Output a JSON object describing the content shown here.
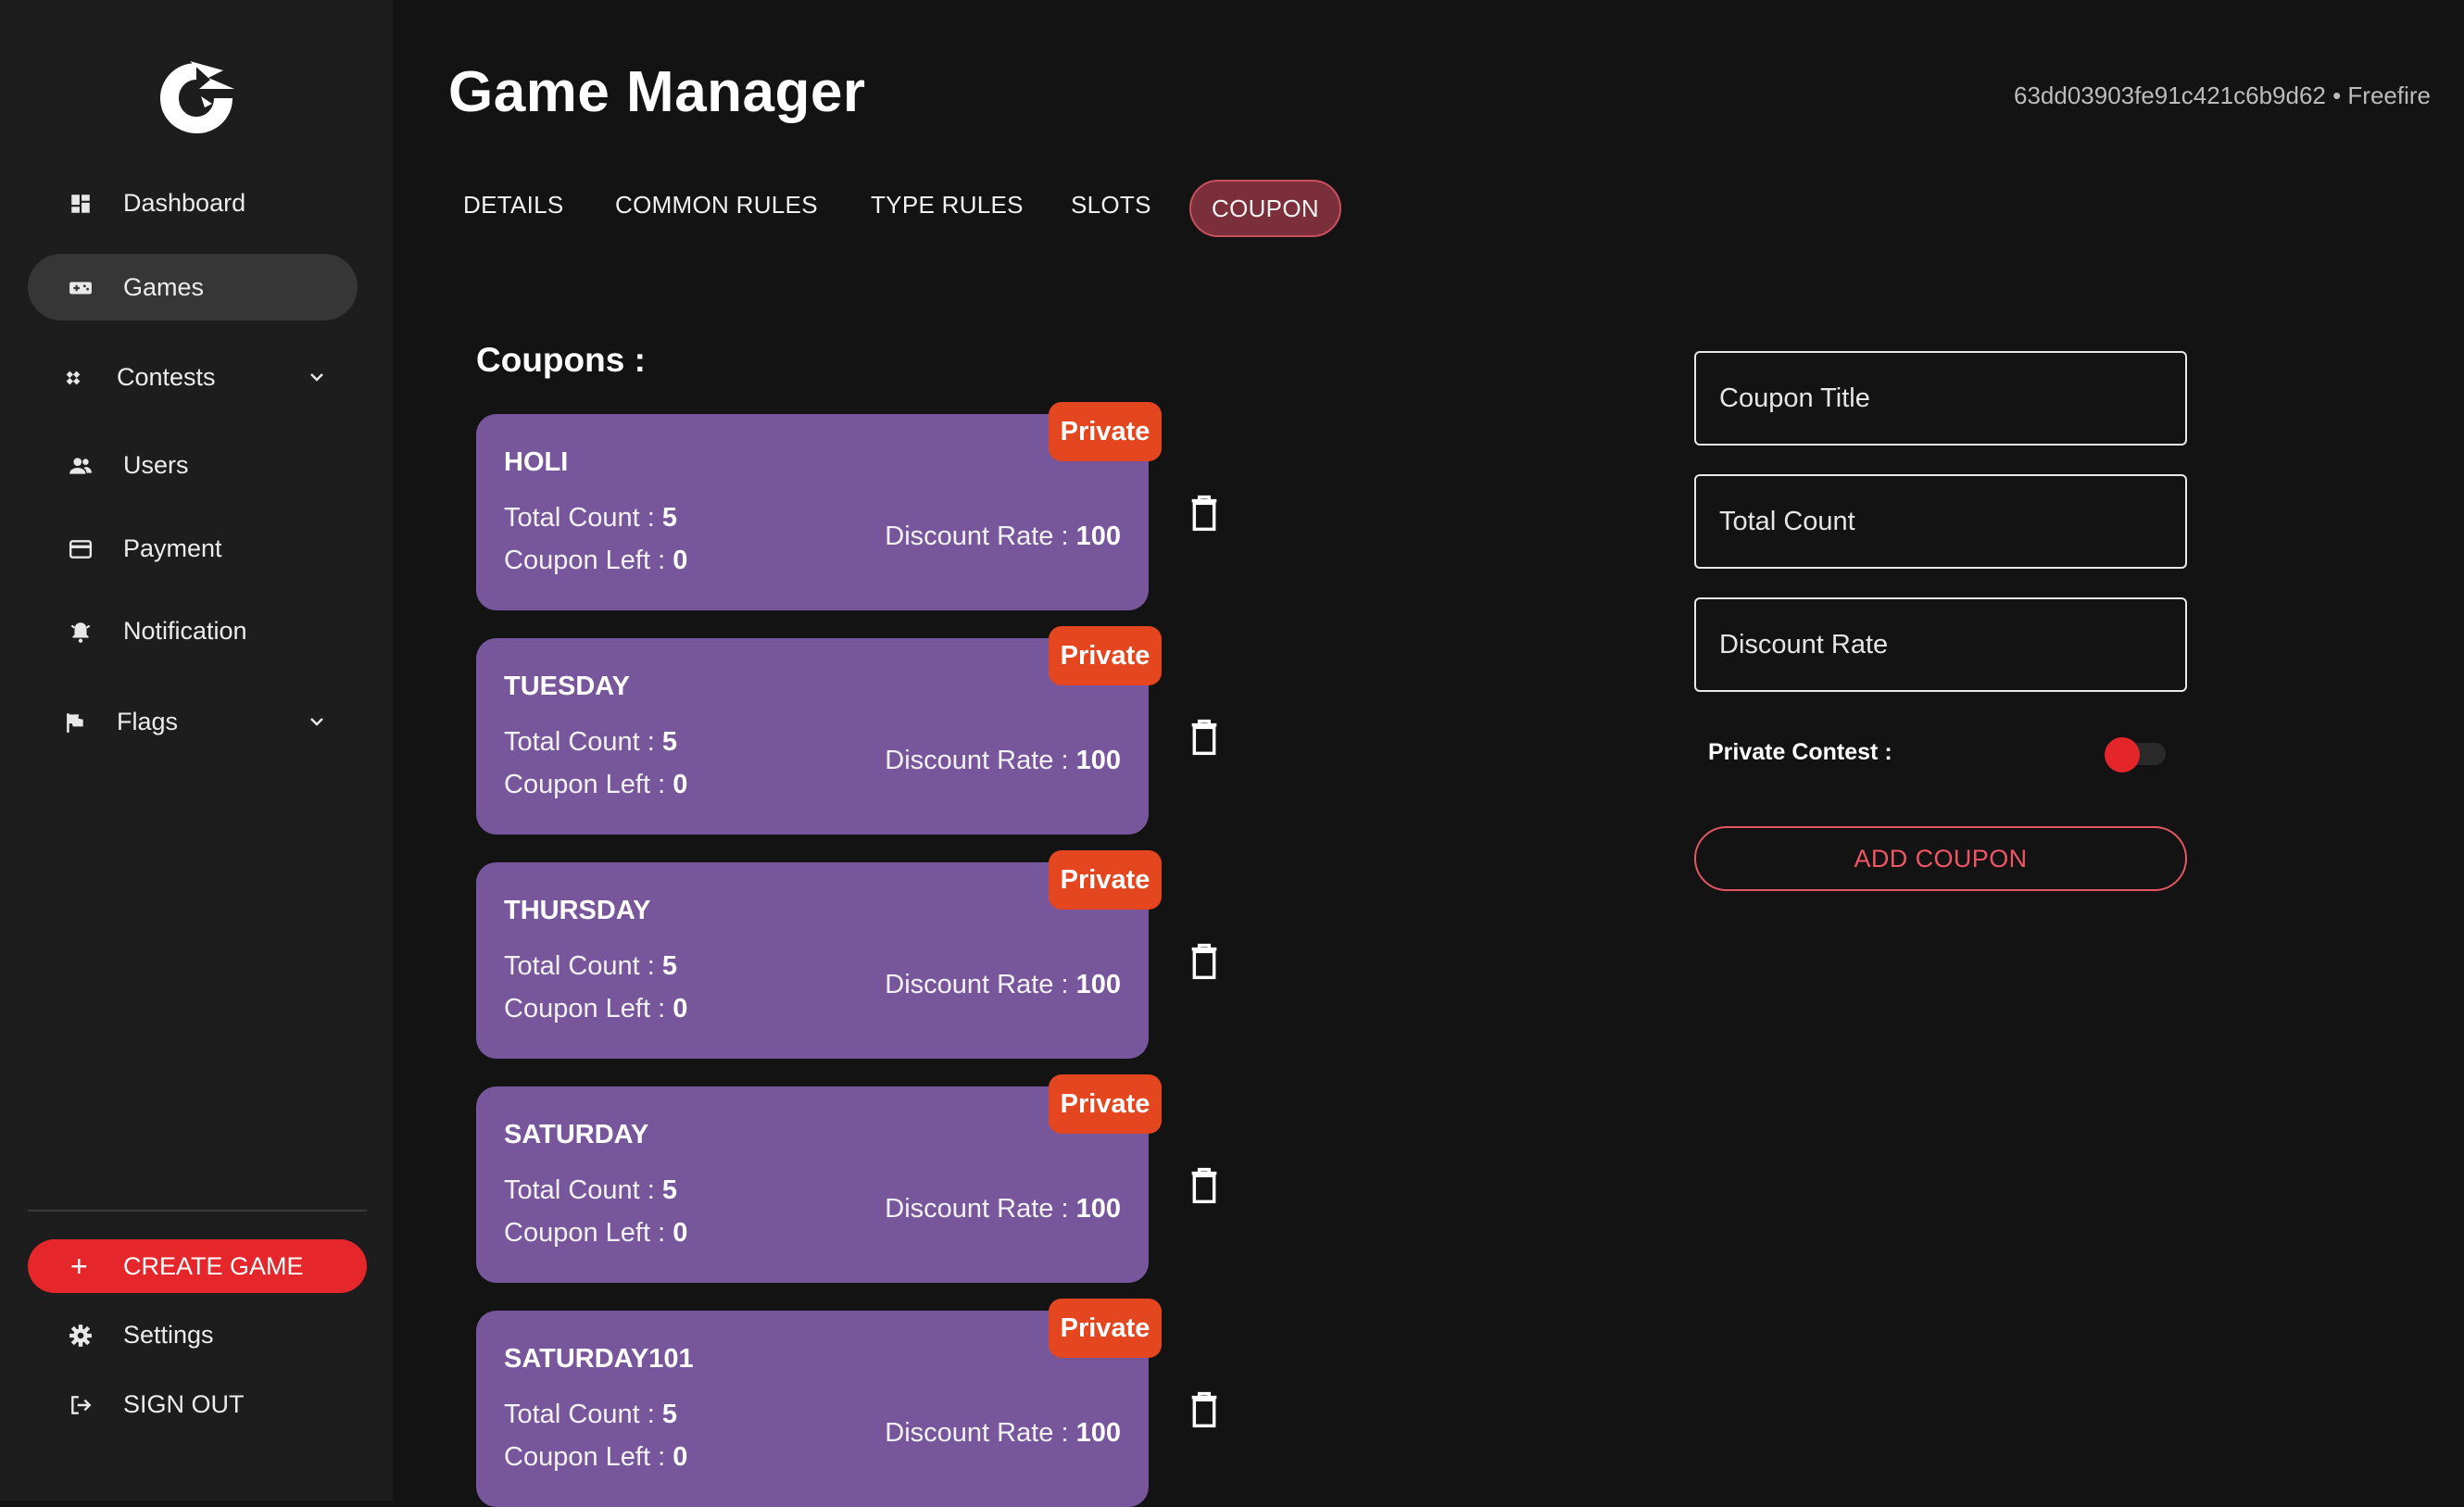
{
  "sidebar": {
    "items": [
      {
        "label": "Dashboard",
        "icon": "dashboard-icon"
      },
      {
        "label": "Games",
        "icon": "gamepad-icon",
        "active": true
      },
      {
        "label": "Contests",
        "icon": "contests-icon",
        "expandable": true
      },
      {
        "label": "Users",
        "icon": "users-icon"
      },
      {
        "label": "Payment",
        "icon": "credit-card-icon"
      },
      {
        "label": "Notification",
        "icon": "bell-icon"
      },
      {
        "label": "Flags",
        "icon": "flag-icon",
        "expandable": true
      }
    ],
    "create_game": "CREATE GAME",
    "settings": "Settings",
    "sign_out": "SIGN OUT"
  },
  "header": {
    "title": "Game Manager",
    "game_id": "63dd03903fe91c421c6b9d62 • Freefire"
  },
  "tabs": [
    "DETAILS",
    "COMMON RULES",
    "TYPE RULES",
    "SLOTS",
    "COUPON"
  ],
  "active_tab": "COUPON",
  "coupons_title": "Coupons :",
  "coupon_labels": {
    "total_count": "Total Count :",
    "coupon_left": "Coupon Left :",
    "discount_rate": "Discount Rate :",
    "badge": "Private"
  },
  "coupons": [
    {
      "name": "HOLI",
      "total_count": "5",
      "coupon_left": "0",
      "discount_rate": "100"
    },
    {
      "name": "TUESDAY",
      "total_count": "5",
      "coupon_left": "0",
      "discount_rate": "100"
    },
    {
      "name": "THURSDAY",
      "total_count": "5",
      "coupon_left": "0",
      "discount_rate": "100"
    },
    {
      "name": "SATURDAY",
      "total_count": "5",
      "coupon_left": "0",
      "discount_rate": "100"
    },
    {
      "name": "SATURDAY101",
      "total_count": "5",
      "coupon_left": "0",
      "discount_rate": "100"
    }
  ],
  "form": {
    "coupon_title_placeholder": "Coupon Title",
    "total_count_placeholder": "Total Count",
    "discount_rate_placeholder": "Discount Rate",
    "private_contest_label": "Private Contest :",
    "add_button": "ADD COUPON"
  },
  "colors": {
    "background": "#131313",
    "sidebar": "#1d1d1d",
    "card": "#77569c",
    "badge": "#e4471f",
    "accent_red": "#e5262a"
  }
}
